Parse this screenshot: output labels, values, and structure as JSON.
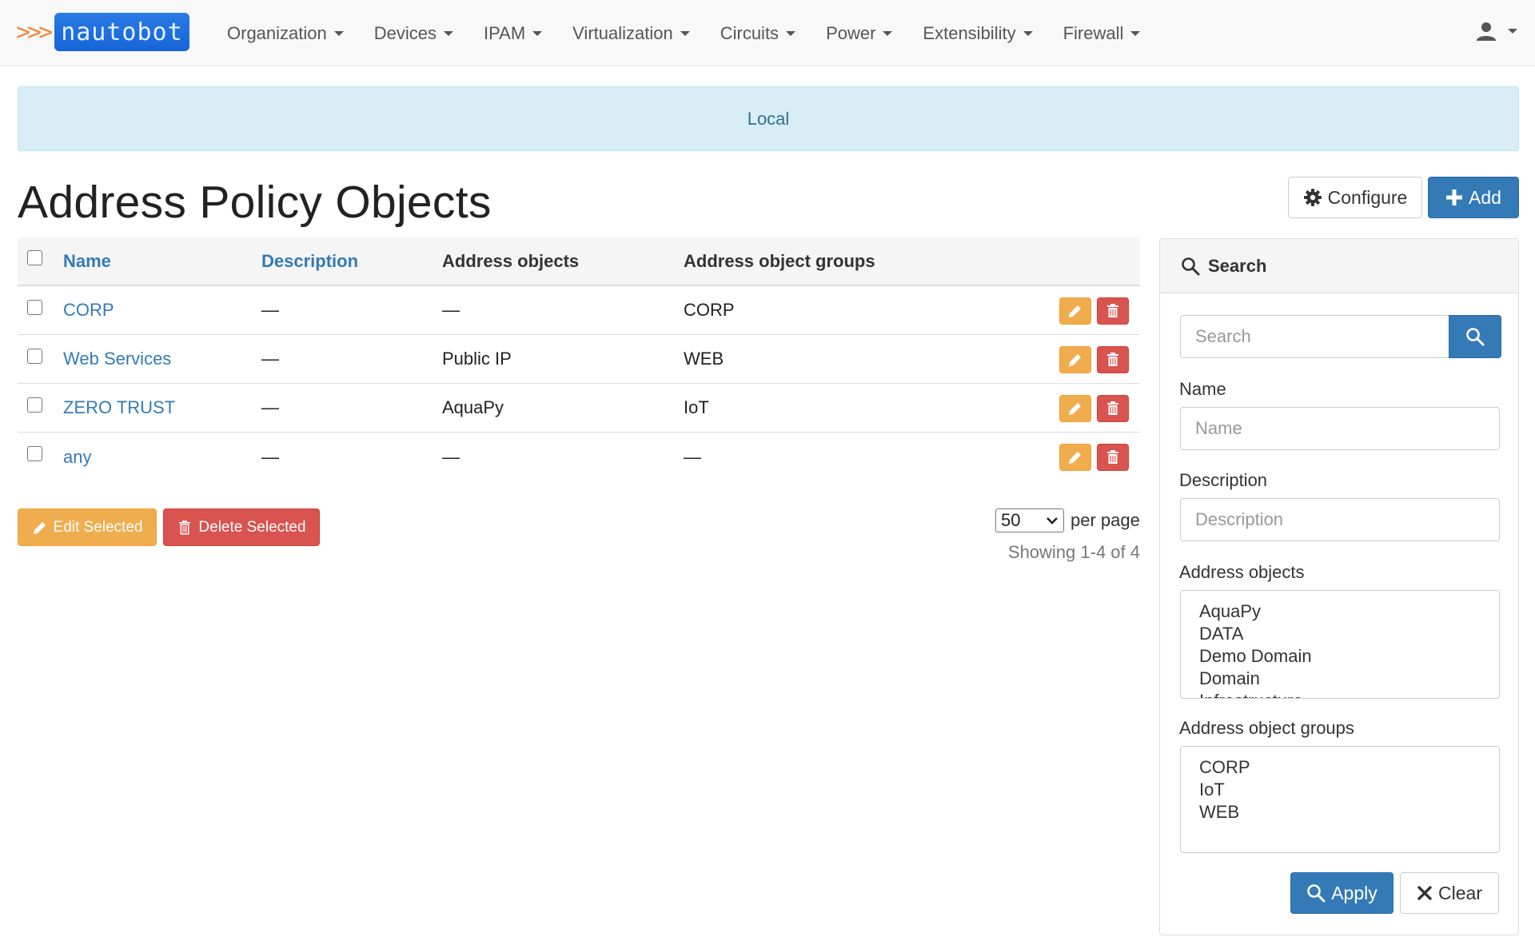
{
  "app": {
    "logo_arrows": ">>>",
    "logo_text": "nautobot"
  },
  "nav": {
    "items": [
      {
        "label": "Organization"
      },
      {
        "label": "Devices"
      },
      {
        "label": "IPAM"
      },
      {
        "label": "Virtualization"
      },
      {
        "label": "Circuits"
      },
      {
        "label": "Power"
      },
      {
        "label": "Extensibility"
      },
      {
        "label": "Firewall"
      }
    ],
    "user_icon": "user-icon"
  },
  "banner": {
    "text": "Local"
  },
  "page": {
    "title": "Address Policy Objects",
    "configure_label": "Configure",
    "add_label": "Add"
  },
  "table": {
    "headers": {
      "name": "Name",
      "description": "Description",
      "address_objects": "Address objects",
      "address_object_groups": "Address object groups"
    },
    "rows": [
      {
        "name": "CORP",
        "description": "—",
        "address_objects": "—",
        "address_object_groups": "CORP"
      },
      {
        "name": "Web Services",
        "description": "—",
        "address_objects": "Public IP",
        "address_object_groups": "WEB"
      },
      {
        "name": "ZERO TRUST",
        "description": "—",
        "address_objects": "AquaPy",
        "address_object_groups": "IoT"
      },
      {
        "name": "any",
        "description": "—",
        "address_objects": "—",
        "address_object_groups": "—"
      }
    ]
  },
  "bulk": {
    "edit_label": "Edit Selected",
    "delete_label": "Delete Selected"
  },
  "pagination": {
    "per_page_value": "50",
    "per_page_label": "per page",
    "showing": "Showing 1-4 of 4"
  },
  "search_panel": {
    "title": "Search",
    "search_placeholder": "Search",
    "name_label": "Name",
    "name_placeholder": "Name",
    "description_label": "Description",
    "description_placeholder": "Description",
    "address_objects_label": "Address objects",
    "address_objects_options": [
      "AquaPy",
      "DATA",
      "Demo Domain",
      "Domain",
      "Infrastructure"
    ],
    "address_object_groups_label": "Address object groups",
    "address_object_groups_options": [
      "CORP",
      "IoT",
      "WEB"
    ],
    "apply_label": "Apply",
    "clear_label": "Clear"
  },
  "colors": {
    "primary": "#337ab7",
    "warning": "#f0ad4e",
    "danger": "#d9534f",
    "info_bg": "#d9edf7",
    "info_text": "#31708f"
  }
}
